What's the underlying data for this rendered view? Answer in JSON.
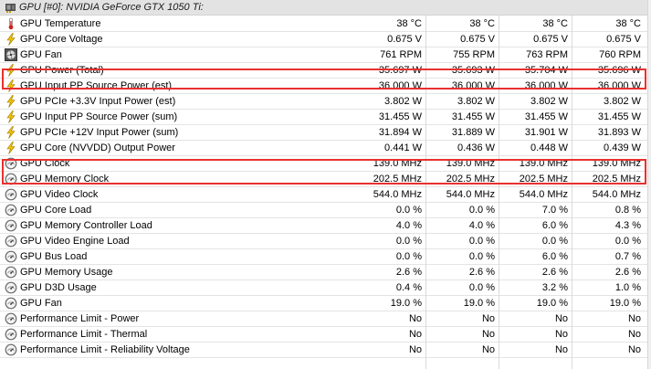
{
  "window": {
    "header_label": "GPU [#0]: NVIDIA GeForce GTX 1050 Ti:"
  },
  "colors": {
    "highlight": "#e8312f",
    "bolt": "#f2c200",
    "thermometer": "#d02020",
    "gauge": "#6a6a6a"
  },
  "rows": [
    {
      "label": "GPU Temperature",
      "icon": "thermometer-icon",
      "values": [
        "38 °C",
        "38 °C",
        "38 °C",
        "38 °C"
      ]
    },
    {
      "label": "GPU Core Voltage",
      "icon": "lightning-bolt-icon",
      "values": [
        "0.675 V",
        "0.675 V",
        "0.675 V",
        "0.675 V"
      ]
    },
    {
      "label": "GPU Fan",
      "icon": "fan-icon",
      "values": [
        "761 RPM",
        "755 RPM",
        "763 RPM",
        "760 RPM"
      ]
    },
    {
      "label": "GPU Power (Total)",
      "icon": "lightning-bolt-icon",
      "values": [
        "35.697 W",
        "35.693 W",
        "35.704 W",
        "35.696 W"
      ]
    },
    {
      "label": "GPU Input PP Source Power (est)",
      "icon": "lightning-bolt-icon",
      "values": [
        "36.000 W",
        "36.000 W",
        "36.000 W",
        "36.000 W"
      ]
    },
    {
      "label": "GPU PCIe +3.3V Input Power (est)",
      "icon": "lightning-bolt-icon",
      "values": [
        "3.802 W",
        "3.802 W",
        "3.802 W",
        "3.802 W"
      ]
    },
    {
      "label": "GPU Input PP Source Power (sum)",
      "icon": "lightning-bolt-icon",
      "values": [
        "31.455 W",
        "31.455 W",
        "31.455 W",
        "31.455 W"
      ]
    },
    {
      "label": "GPU PCIe +12V Input Power (sum)",
      "icon": "lightning-bolt-icon",
      "values": [
        "31.894 W",
        "31.889 W",
        "31.901 W",
        "31.893 W"
      ]
    },
    {
      "label": "GPU Core (NVVDD) Output Power",
      "icon": "lightning-bolt-icon",
      "values": [
        "0.441 W",
        "0.436 W",
        "0.448 W",
        "0.439 W"
      ]
    },
    {
      "label": "GPU Clock",
      "icon": "gauge-icon",
      "values": [
        "139.0 MHz",
        "139.0 MHz",
        "139.0 MHz",
        "139.0 MHz"
      ]
    },
    {
      "label": "GPU Memory Clock",
      "icon": "gauge-icon",
      "values": [
        "202.5 MHz",
        "202.5 MHz",
        "202.5 MHz",
        "202.5 MHz"
      ]
    },
    {
      "label": "GPU Video Clock",
      "icon": "gauge-icon",
      "values": [
        "544.0 MHz",
        "544.0 MHz",
        "544.0 MHz",
        "544.0 MHz"
      ]
    },
    {
      "label": "GPU Core Load",
      "icon": "gauge-icon",
      "values": [
        "0.0 %",
        "0.0 %",
        "7.0 %",
        "0.8 %"
      ]
    },
    {
      "label": "GPU Memory Controller Load",
      "icon": "gauge-icon",
      "values": [
        "4.0 %",
        "4.0 %",
        "6.0 %",
        "4.3 %"
      ]
    },
    {
      "label": "GPU Video Engine Load",
      "icon": "gauge-icon",
      "values": [
        "0.0 %",
        "0.0 %",
        "0.0 %",
        "0.0 %"
      ]
    },
    {
      "label": "GPU Bus Load",
      "icon": "gauge-icon",
      "values": [
        "0.0 %",
        "0.0 %",
        "6.0 %",
        "0.7 %"
      ]
    },
    {
      "label": "GPU Memory Usage",
      "icon": "gauge-icon",
      "values": [
        "2.6 %",
        "2.6 %",
        "2.6 %",
        "2.6 %"
      ]
    },
    {
      "label": "GPU D3D Usage",
      "icon": "gauge-icon",
      "values": [
        "0.4 %",
        "0.0 %",
        "3.2 %",
        "1.0 %"
      ]
    },
    {
      "label": "GPU Fan",
      "icon": "gauge-icon",
      "values": [
        "19.0 %",
        "19.0 %",
        "19.0 %",
        "19.0 %"
      ]
    },
    {
      "label": "Performance Limit - Power",
      "icon": "gauge-icon",
      "values": [
        "No",
        "No",
        "No",
        "No"
      ]
    },
    {
      "label": "Performance Limit - Thermal",
      "icon": "gauge-icon",
      "values": [
        "No",
        "No",
        "No",
        "No"
      ]
    },
    {
      "label": "Performance Limit - Reliability Voltage",
      "icon": "gauge-icon",
      "values": [
        "No",
        "No",
        "No",
        "No"
      ]
    }
  ]
}
